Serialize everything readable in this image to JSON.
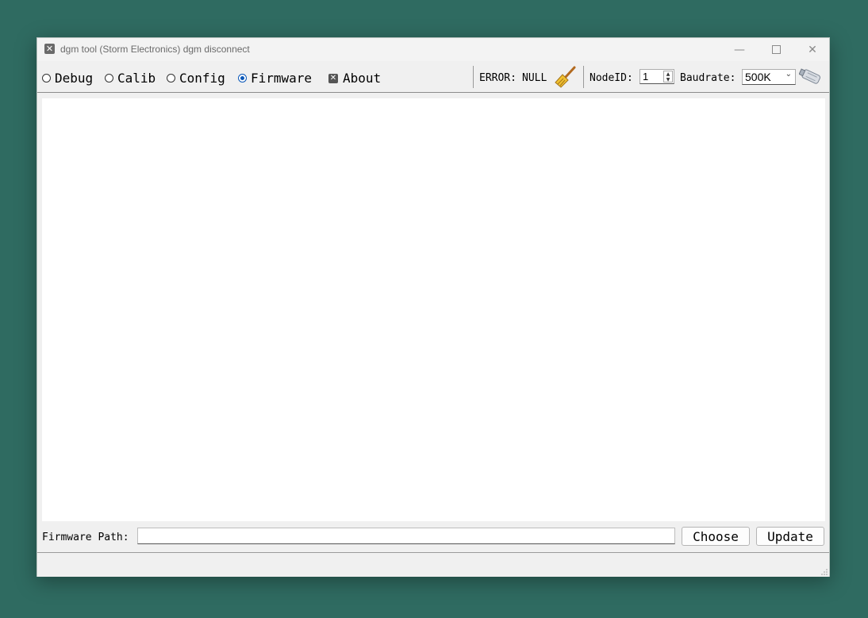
{
  "window": {
    "title": "dgm tool (Storm Electronics)  dgm disconnect",
    "minimize_icon": "minimize-icon",
    "maximize_icon": "maximize-icon",
    "close_icon": "close-icon"
  },
  "nav": {
    "options": [
      {
        "label": "Debug",
        "checked": false
      },
      {
        "label": "Calib",
        "checked": false
      },
      {
        "label": "Config",
        "checked": false
      },
      {
        "label": "Firmware",
        "checked": true
      }
    ],
    "about_label": "About"
  },
  "status": {
    "error_label": "ERROR:",
    "error_value": "NULL",
    "clear_icon": "broom-icon"
  },
  "connection": {
    "nodeid_label": "NodeID:",
    "nodeid_value": "1",
    "baudrate_label": "Baudrate:",
    "baudrate_value": "500K",
    "connect_icon": "usb-adapter-icon"
  },
  "firmware": {
    "path_label": "Firmware Path:",
    "path_value": "",
    "choose_label": "Choose",
    "update_label": "Update"
  },
  "colors": {
    "desktop": "#2f6b61",
    "accent": "#0a57b8"
  }
}
